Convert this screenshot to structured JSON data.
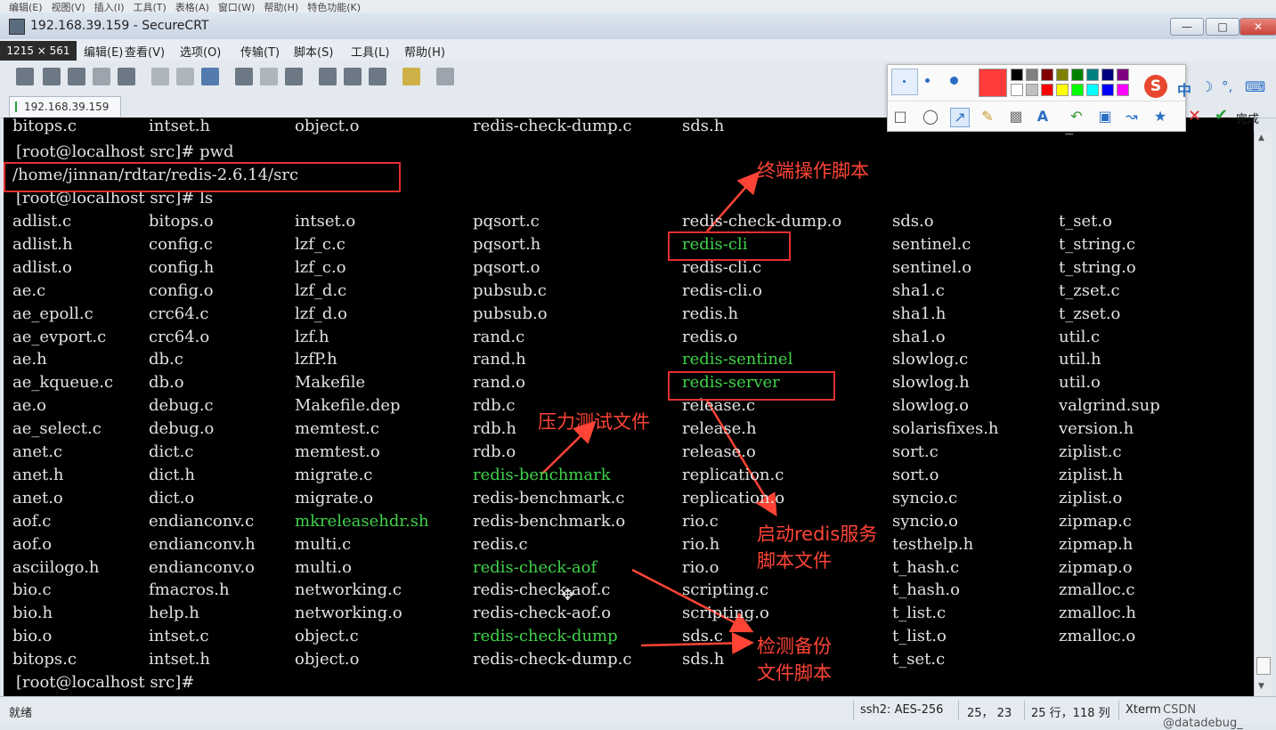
{
  "outer_menu": [
    "编辑(E)",
    "视图(V)",
    "插入(I)",
    "工具(T)",
    "表格(A)",
    "窗口(W)",
    "帮助(H)",
    "特色功能(K)"
  ],
  "window": {
    "title": "192.168.39.159 - SecureCRT"
  },
  "size_badge": "1215 × 561",
  "menu": [
    "编辑(E)",
    "查看(V)",
    "选项(O)",
    "传输(T)",
    "脚本(S)",
    "工具(L)",
    "帮助(H)"
  ],
  "session_tab": "192.168.39.159",
  "terminal": {
    "top_partial_row": [
      "bitops.c",
      "intset.h",
      "object.o",
      "redis-check-dump.c",
      "sds.h",
      "",
      "t_set.c"
    ],
    "prompt_pwd": "[root@localhost src]# pwd",
    "pwd_output": "/home/jinnan/rdtar/redis-2.6.14/src",
    "prompt_ls": "[root@localhost src]# ls",
    "columns": [
      [
        "adlist.c",
        "adlist.h",
        "adlist.o",
        "ae.c",
        "ae_epoll.c",
        "ae_evport.c",
        "ae.h",
        "ae_kqueue.c",
        "ae.o",
        "ae_select.c",
        "anet.c",
        "anet.h",
        "anet.o",
        "aof.c",
        "aof.o",
        "asciilogo.h",
        "bio.c",
        "bio.h",
        "bio.o",
        "bitops.c"
      ],
      [
        "bitops.o",
        "config.c",
        "config.h",
        "config.o",
        "crc64.c",
        "crc64.o",
        "db.c",
        "db.o",
        "debug.c",
        "debug.o",
        "dict.c",
        "dict.h",
        "dict.o",
        "endianconv.c",
        "endianconv.h",
        "endianconv.o",
        "fmacros.h",
        "help.h",
        "intset.c",
        "intset.h"
      ],
      [
        "intset.o",
        "lzf_c.c",
        "lzf_c.o",
        "lzf_d.c",
        "lzf_d.o",
        "lzf.h",
        "lzfP.h",
        "Makefile",
        "Makefile.dep",
        "memtest.c",
        "memtest.o",
        "migrate.c",
        "migrate.o",
        "mkreleasehdr.sh",
        "multi.c",
        "multi.o",
        "networking.c",
        "networking.o",
        "object.c",
        "object.o"
      ],
      [
        "pqsort.c",
        "pqsort.h",
        "pqsort.o",
        "pubsub.c",
        "pubsub.o",
        "rand.c",
        "rand.h",
        "rand.o",
        "rdb.c",
        "rdb.h",
        "rdb.o",
        "redis-benchmark",
        "redis-benchmark.c",
        "redis-benchmark.o",
        "redis.c",
        "redis-check-aof",
        "redis-check-aof.c",
        "redis-check-aof.o",
        "redis-check-dump",
        "redis-check-dump.c"
      ],
      [
        "redis-check-dump.o",
        "redis-cli",
        "redis-cli.c",
        "redis-cli.o",
        "redis.h",
        "redis.o",
        "redis-sentinel",
        "redis-server",
        "release.c",
        "release.h",
        "release.o",
        "replication.c",
        "replication.o",
        "rio.c",
        "rio.h",
        "rio.o",
        "scripting.c",
        "scripting.o",
        "sds.c",
        "sds.h"
      ],
      [
        "sds.o",
        "sentinel.c",
        "sentinel.o",
        "sha1.c",
        "sha1.h",
        "sha1.o",
        "slowlog.c",
        "slowlog.h",
        "slowlog.o",
        "solarisfixes.h",
        "sort.c",
        "sort.o",
        "syncio.c",
        "syncio.o",
        "testhelp.h",
        "t_hash.c",
        "t_hash.o",
        "t_list.c",
        "t_list.o",
        "t_set.c"
      ],
      [
        "t_set.o",
        "t_string.c",
        "t_string.o",
        "t_zset.c",
        "t_zset.o",
        "util.c",
        "util.h",
        "util.o",
        "valgrind.sup",
        "version.h",
        "ziplist.c",
        "ziplist.h",
        "ziplist.o",
        "zipmap.c",
        "zipmap.h",
        "zipmap.o",
        "zmalloc.c",
        "zmalloc.h",
        "zmalloc.o",
        ""
      ]
    ],
    "executables": [
      "mkreleasehdr.sh",
      "redis-benchmark",
      "redis-check-aof",
      "redis-check-dump",
      "redis-cli",
      "redis-sentinel",
      "redis-server"
    ],
    "final_prompt": "[root@localhost src]#"
  },
  "annotations": {
    "cli": "终端操作脚本",
    "benchmark": "压力测试文件",
    "server_line1": "启动redis服务",
    "server_line2": "脚本文件",
    "check_line1": "检测备份",
    "check_line2": "文件脚本",
    "color": "#ff4436"
  },
  "palette": {
    "colors": [
      "#000000",
      "#808080",
      "#800000",
      "#808000",
      "#008000",
      "#008080",
      "#000080",
      "#800080",
      "#ffffff",
      "#c0c0c0",
      "#ff0000",
      "#ffff00",
      "#00ff00",
      "#00ffff",
      "#0000ff",
      "#ff00ff"
    ],
    "selected_color": "#ff3b3b",
    "done_label": "完成"
  },
  "statusbar": {
    "status": "就绪",
    "cipher": "ssh2: AES-256",
    "cursor": "25， 23",
    "size": "25 行，118 列",
    "term": "Xterm",
    "watermark": "CSDN @datadebug_"
  }
}
